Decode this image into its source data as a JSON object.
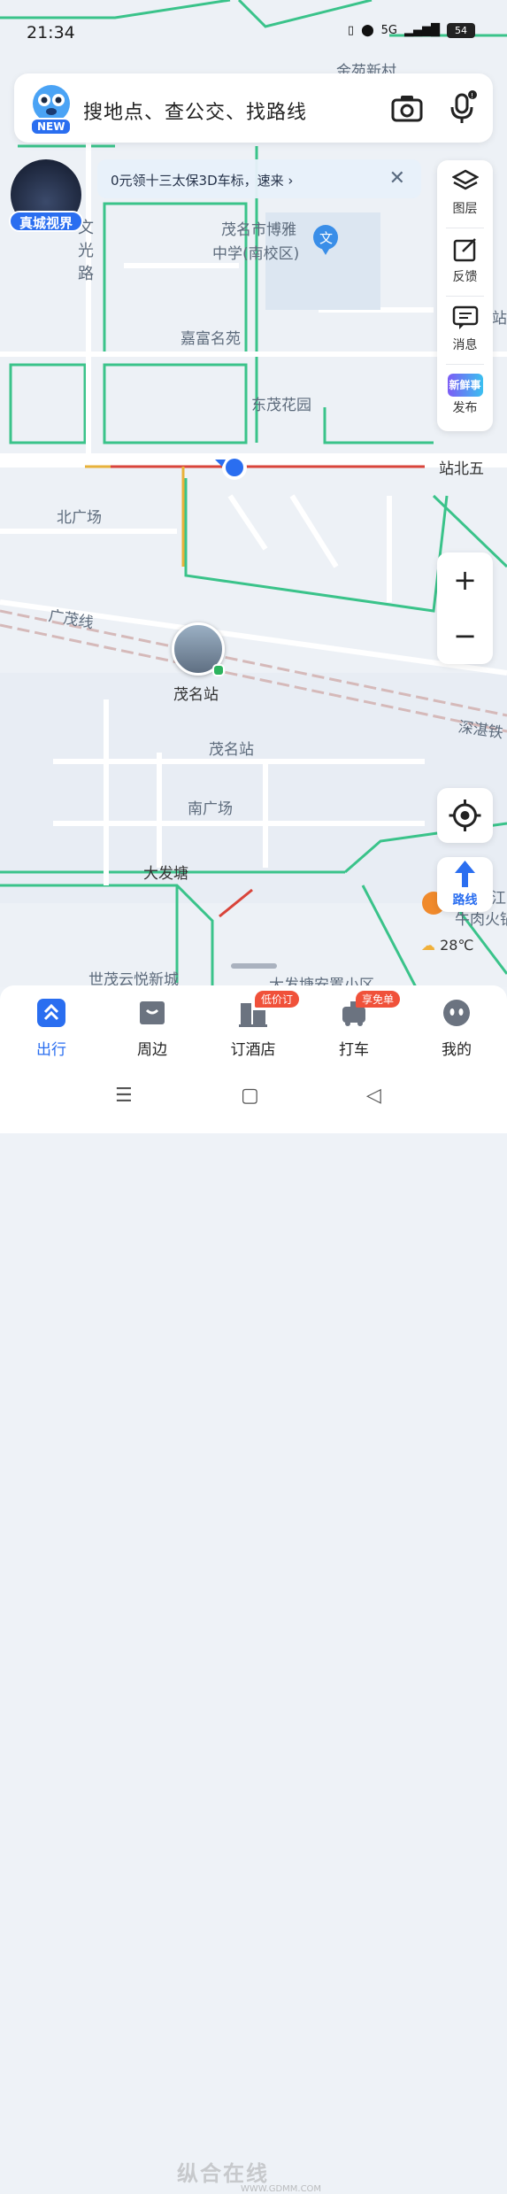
{
  "status_bar": {
    "time": "21:34",
    "network": "5G",
    "battery": "54"
  },
  "search": {
    "new_badge": "NEW",
    "placeholder": "搜地点、查公交、找路线"
  },
  "notice": {
    "text": "0元领十三太保3D车标，速来 ›",
    "close": "✕"
  },
  "city_view": {
    "label": "真城视界"
  },
  "side_panel": {
    "items": [
      {
        "label": "图层",
        "icon": "layers-icon"
      },
      {
        "label": "反馈",
        "icon": "feedback-icon"
      },
      {
        "label": "消息",
        "icon": "message-icon"
      },
      {
        "label": "发布",
        "icon": "publish-icon"
      }
    ],
    "publish_tag": "新鲜事"
  },
  "zoom": {
    "in": "+",
    "out": "−"
  },
  "route": {
    "label": "路线"
  },
  "weather": {
    "temp": "28℃"
  },
  "map_labels": {
    "wenguang_road": "文\n光\n路",
    "school_1": "茂名市博雅",
    "school_2": "中学(南校区)",
    "jiafu": "嘉富名苑",
    "dongmao": "东茂花园",
    "zhanbeiwu": "站北五",
    "beiguangchang": "北广场",
    "guangmao_line": "广茂线",
    "station_name": "茂名站",
    "station_label2": "茂名站",
    "nanguangchang": "南广场",
    "dafatang": "大发塘",
    "shimao": "世茂云悦新城",
    "dafatang_area": "大发塘安置小区",
    "shenzhan": "深湛铁",
    "jin": "金苑新村",
    "jiang": "江",
    "huoche": "牛肉火锅",
    "zhan_l": "站"
  },
  "tabs": [
    {
      "label": "出行",
      "icon": "travel-icon",
      "active": true
    },
    {
      "label": "周边",
      "icon": "nearby-icon"
    },
    {
      "label": "订酒店",
      "icon": "hotel-icon",
      "badge": "低价订"
    },
    {
      "label": "打车",
      "icon": "taxi-icon",
      "badge": "享免单"
    },
    {
      "label": "我的",
      "icon": "profile-icon"
    }
  ],
  "watermark": {
    "main": "纵合在线",
    "sub": "WWW.GDMM.COM"
  },
  "colors": {
    "accent": "#2a6ef0",
    "road_outline": "#3ac38a",
    "traffic_red": "#d9443a",
    "traffic_yellow": "#e8b23a"
  }
}
